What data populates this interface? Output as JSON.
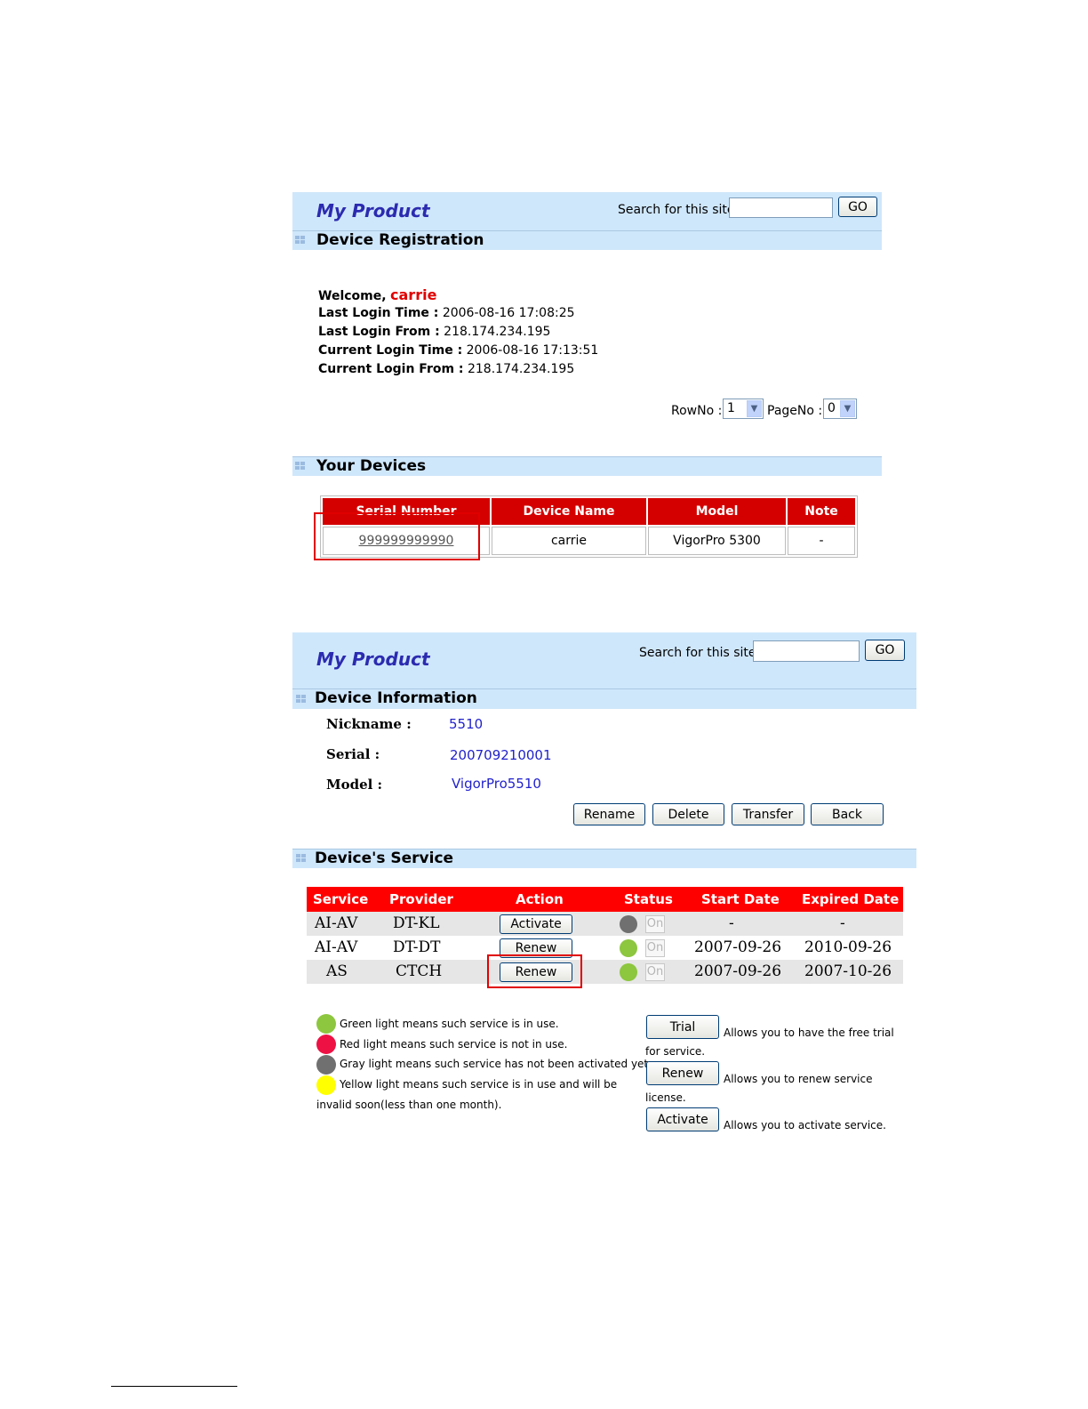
{
  "panel1": {
    "title": "My Product",
    "search_label": "Search for this site",
    "search_value": "",
    "go_label": "GO",
    "section_registration": "Device Registration",
    "welcome_label": "Welcome,",
    "username": "carrie",
    "login_lines": [
      {
        "label": "Last Login Time :",
        "value": "2006-08-16  17:08:25"
      },
      {
        "label": "Last Login From :",
        "value": "218.174.234.195"
      },
      {
        "label": "Current Login Time :",
        "value": "2006-08-16  17:13:51"
      },
      {
        "label": "Current Login From :",
        "value": "218.174.234.195"
      }
    ],
    "rowno_label": "RowNo :",
    "rowno_value": "1",
    "pageno_label": "PageNo :",
    "pageno_value": "0",
    "section_devices": "Your Devices",
    "devices_table": {
      "headers": [
        "Serial Number",
        "Device Name",
        "Model",
        "Note"
      ],
      "rows": [
        [
          "999999999990",
          "carrie",
          "VigorPro 5300",
          "-"
        ]
      ]
    }
  },
  "panel2": {
    "title": "My Product",
    "search_label": "Search for this site",
    "search_value": "",
    "go_label": "GO",
    "section_info": "Device Information",
    "nickname_label": "Nickname :",
    "nickname_value": "5510",
    "serial_label": "Serial :",
    "serial_value": "200709210001",
    "model_label": "Model :",
    "model_value": "VigorPro5510",
    "buttons": {
      "rename": "Rename",
      "delete": "Delete",
      "transfer": "Transfer",
      "back": "Back"
    },
    "section_service": "Device's Service",
    "service_table": {
      "headers": [
        "Service",
        "Provider",
        "Action",
        "Status",
        "Start Date",
        "Expired Date"
      ],
      "rows": [
        {
          "service": "AI-AV",
          "provider": "DT-KL",
          "action": "Activate",
          "status_color": "#707070",
          "toggle": "On",
          "start": "-",
          "expired": "-"
        },
        {
          "service": "AI-AV",
          "provider": "DT-DT",
          "action": "Renew",
          "status_color": "#8dc63f",
          "toggle": "On",
          "start": "2007-09-26",
          "expired": "2010-09-26"
        },
        {
          "service": "AS",
          "provider": "CTCH",
          "action": "Renew",
          "status_color": "#8dc63f",
          "toggle": "On",
          "start": "2007-09-26",
          "expired": "2007-10-26"
        }
      ]
    },
    "legend": [
      {
        "color": "#8dc63f",
        "text": "Green light means such service is in use."
      },
      {
        "color": "#ee1144",
        "text": "Red light means such service is not in use."
      },
      {
        "color": "#707070",
        "text": "Gray light means such service has not been activated yet."
      },
      {
        "color": "#ffff00",
        "text": "Yellow light means such service is in use and will be"
      }
    ],
    "legend_continuation": "invalid soon(less than one month).",
    "help": [
      {
        "button": "Trial",
        "text": "Allows you to have the free trial",
        "cont": "for service."
      },
      {
        "button": "Renew",
        "text": "Allows you to renew service",
        "cont": "license."
      },
      {
        "button": "Activate",
        "text": "Allows you to activate service.",
        "cont": ""
      }
    ]
  },
  "colors": {
    "header_bg": "#cfe7fb",
    "title_blue": "#2b2bb0",
    "table_red": "#d40000",
    "service_red": "#ff0000",
    "highlight_red": "#e00000",
    "link_blue": "#2222cc"
  }
}
